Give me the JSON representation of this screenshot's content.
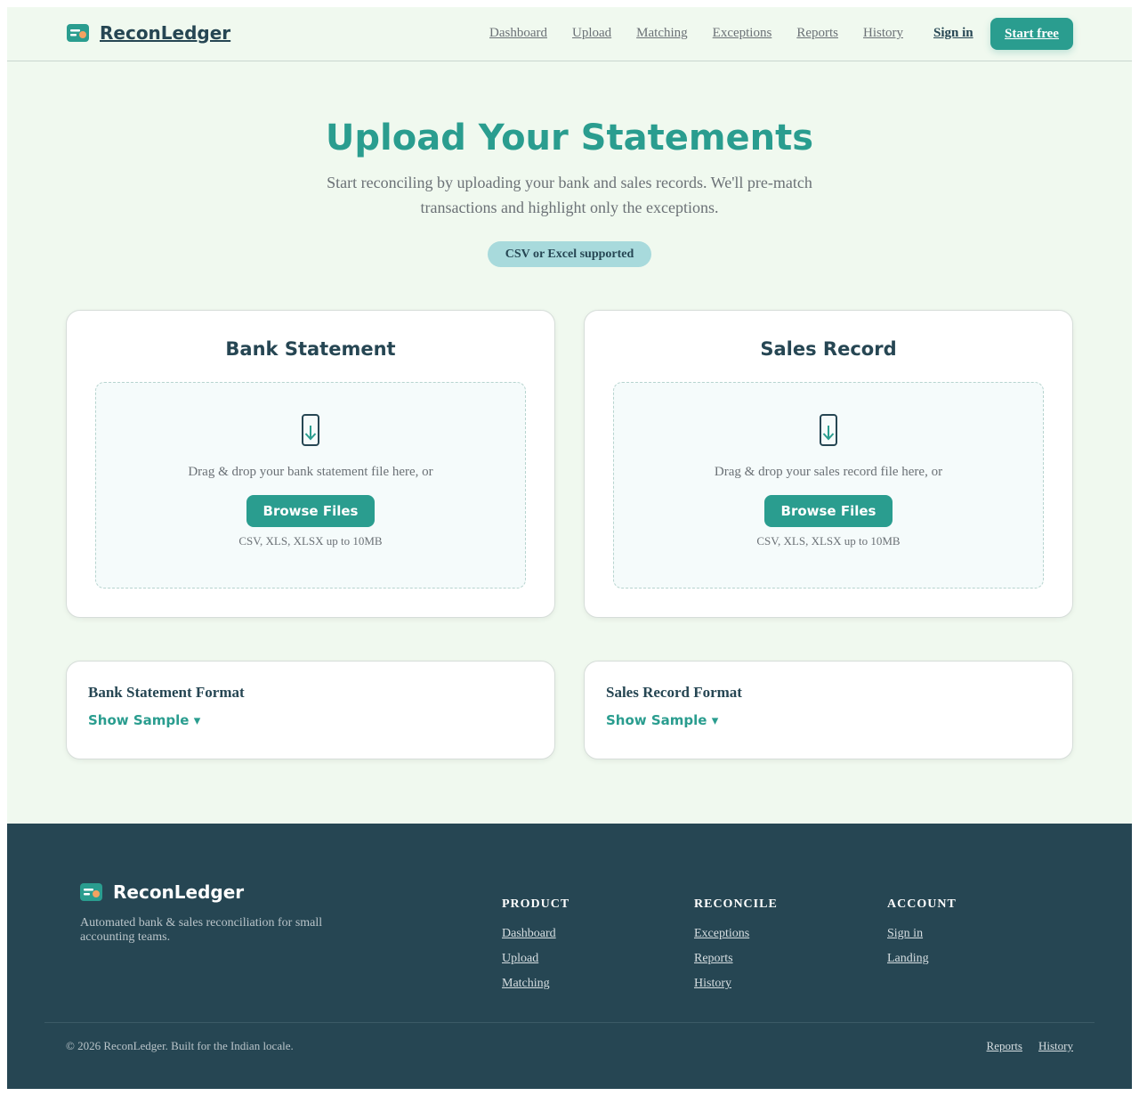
{
  "header": {
    "brand": "ReconLedger",
    "nav": [
      "Dashboard",
      "Upload",
      "Matching",
      "Exceptions",
      "Reports",
      "History"
    ],
    "signin": "Sign in",
    "start": "Start free"
  },
  "hero": {
    "title": "Upload Your Statements",
    "subtitle": "Start reconciling by uploading your bank and sales records. We'll pre-match transactions and highlight only the exceptions.",
    "pill": "CSV or Excel supported"
  },
  "uploads": [
    {
      "title": "Bank Statement",
      "drop_text": "Drag & drop your bank statement file here, or",
      "button": "Browse Files",
      "hint": "CSV, XLS, XLSX up to 10MB"
    },
    {
      "title": "Sales Record",
      "drop_text": "Drag & drop your sales record file here, or",
      "button": "Browse Files",
      "hint": "CSV, XLS, XLSX up to 10MB"
    }
  ],
  "formats": [
    {
      "title": "Bank Statement Format",
      "toggle": "Show Sample ▾"
    },
    {
      "title": "Sales Record Format",
      "toggle": "Show Sample ▾"
    }
  ],
  "footer": {
    "brand": "ReconLedger",
    "description": "Automated bank & sales reconciliation for small accounting teams.",
    "columns": [
      {
        "heading": "PRODUCT",
        "links": [
          "Dashboard",
          "Upload",
          "Matching"
        ]
      },
      {
        "heading": "RECONCILE",
        "links": [
          "Exceptions",
          "Reports",
          "History"
        ]
      },
      {
        "heading": "ACCOUNT",
        "links": [
          "Sign in",
          "Landing"
        ]
      }
    ],
    "copyright": "© 2026 ReconLedger. Built for the Indian locale.",
    "bottom_links": [
      "Reports",
      "History"
    ]
  },
  "colors": {
    "accent": "#2a9d8f",
    "dark": "#264653",
    "background": "#f0f9ef",
    "pill": "#a8dadc",
    "logo_dot": "#f4a261"
  },
  "icons": {
    "logo": "wallet-card-icon",
    "upload": "download-arrow-icon"
  }
}
